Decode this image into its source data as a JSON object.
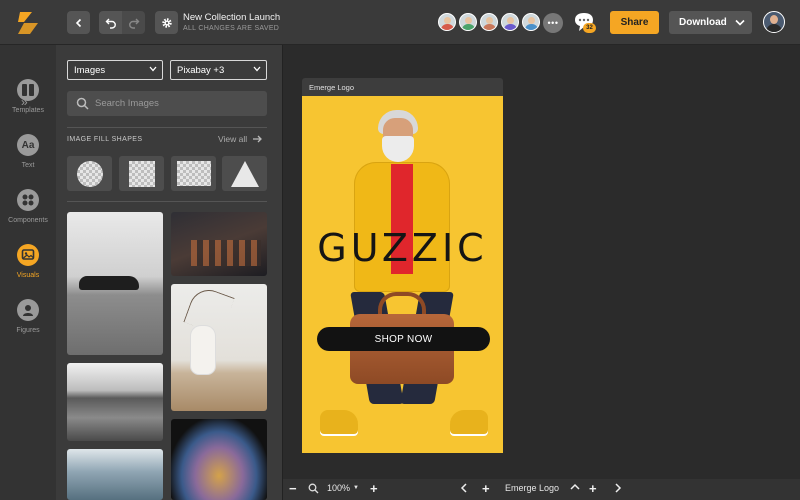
{
  "header": {
    "doc_title": "New Collection Launch",
    "save_status": "ALL CHANGES ARE SAVED",
    "share_label": "Share",
    "download_label": "Download",
    "comment_count": "32",
    "more_collaborators": "•••",
    "collaborator_colors": [
      "#d65a4a",
      "#4aa36b",
      "#c9775a",
      "#6a5acd",
      "#4a90c9"
    ]
  },
  "rail": {
    "items": [
      {
        "label": "Templates",
        "icon": "templates-icon"
      },
      {
        "label": "Text",
        "icon": "text-icon",
        "glyph": "Aa"
      },
      {
        "label": "Components",
        "icon": "components-icon"
      },
      {
        "label": "Visuals",
        "icon": "visuals-icon",
        "active": true
      },
      {
        "label": "Figures",
        "icon": "figures-icon"
      }
    ]
  },
  "panel": {
    "type_select": "Images",
    "source_select": "Pixabay +3",
    "search_placeholder": "Search Images",
    "shapes_title": "IMAGE FILL SHAPES",
    "view_all": "View all"
  },
  "canvas": {
    "design_label": "Emerge Logo",
    "brand_text": "GUZZIC",
    "cta_text": "SHOP NOW",
    "background_color": "#f7c531"
  },
  "footer": {
    "zoom": "100%",
    "page_name": "Emerge Logo"
  },
  "colors": {
    "accent": "#f5a623",
    "topbar": "#3a3a3a",
    "panel": "#3b3b3b"
  }
}
